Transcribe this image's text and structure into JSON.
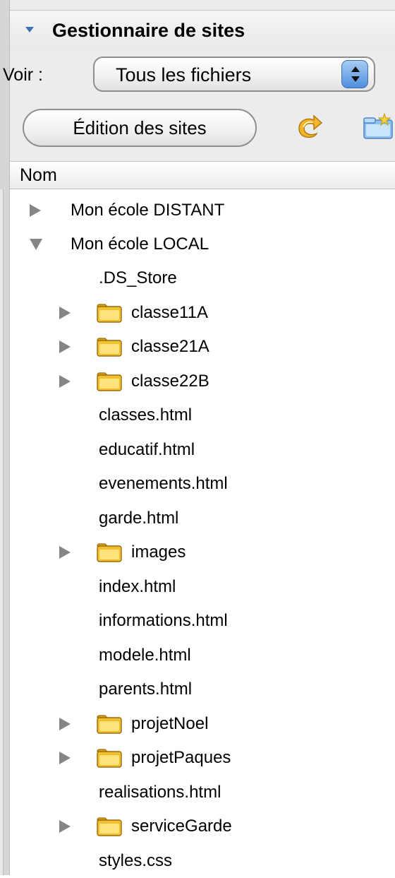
{
  "panel": {
    "title": "Gestionnaire de sites",
    "view_label": "Voir :",
    "view_select_value": "Tous les fichiers",
    "edit_sites_label": "Édition des sites",
    "column_header": "Nom"
  },
  "icons": {
    "refresh": "refresh-icon",
    "new_folder": "new-folder-icon",
    "folder": "folder-icon"
  },
  "colors": {
    "accent": "#4f8fdf",
    "folder": "#f0c030",
    "disclosure": "#858585"
  },
  "tree": {
    "site_remote": "Mon école DISTANT",
    "site_local": "Mon école LOCAL",
    "items": [
      {
        "label": ".DS_Store",
        "type": "file"
      },
      {
        "label": "classe11A",
        "type": "folder"
      },
      {
        "label": "classe21A",
        "type": "folder"
      },
      {
        "label": "classe22B",
        "type": "folder"
      },
      {
        "label": "classes.html",
        "type": "file"
      },
      {
        "label": "educatif.html",
        "type": "file"
      },
      {
        "label": "evenements.html",
        "type": "file"
      },
      {
        "label": "garde.html",
        "type": "file"
      },
      {
        "label": "images",
        "type": "folder"
      },
      {
        "label": "index.html",
        "type": "file"
      },
      {
        "label": "informations.html",
        "type": "file"
      },
      {
        "label": "modele.html",
        "type": "file"
      },
      {
        "label": "parents.html",
        "type": "file"
      },
      {
        "label": "projetNoel",
        "type": "folder"
      },
      {
        "label": "projetPaques",
        "type": "folder"
      },
      {
        "label": "realisations.html",
        "type": "file"
      },
      {
        "label": "serviceGarde",
        "type": "folder"
      },
      {
        "label": "styles.css",
        "type": "file"
      }
    ]
  }
}
